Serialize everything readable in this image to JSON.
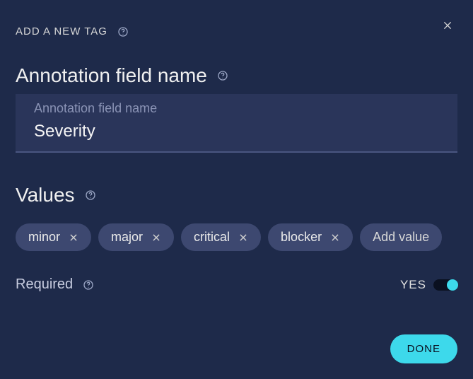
{
  "modal": {
    "title": "ADD A NEW TAG",
    "field_name_section_label": "Annotation field name",
    "field_name_floating_label": "Annotation field name",
    "field_name_value": "Severity",
    "values_section_label": "Values",
    "add_value_label": "Add value",
    "required_label": "Required",
    "toggle_state_label": "YES",
    "done_label": "DONE"
  },
  "chips": [
    {
      "label": "minor"
    },
    {
      "label": "major"
    },
    {
      "label": "critical"
    },
    {
      "label": "blocker"
    }
  ],
  "colors": {
    "accent": "#3dd9eb",
    "bg": "#1e2a4a",
    "chip_bg": "#3d4870",
    "input_bg": "#2a355a"
  }
}
